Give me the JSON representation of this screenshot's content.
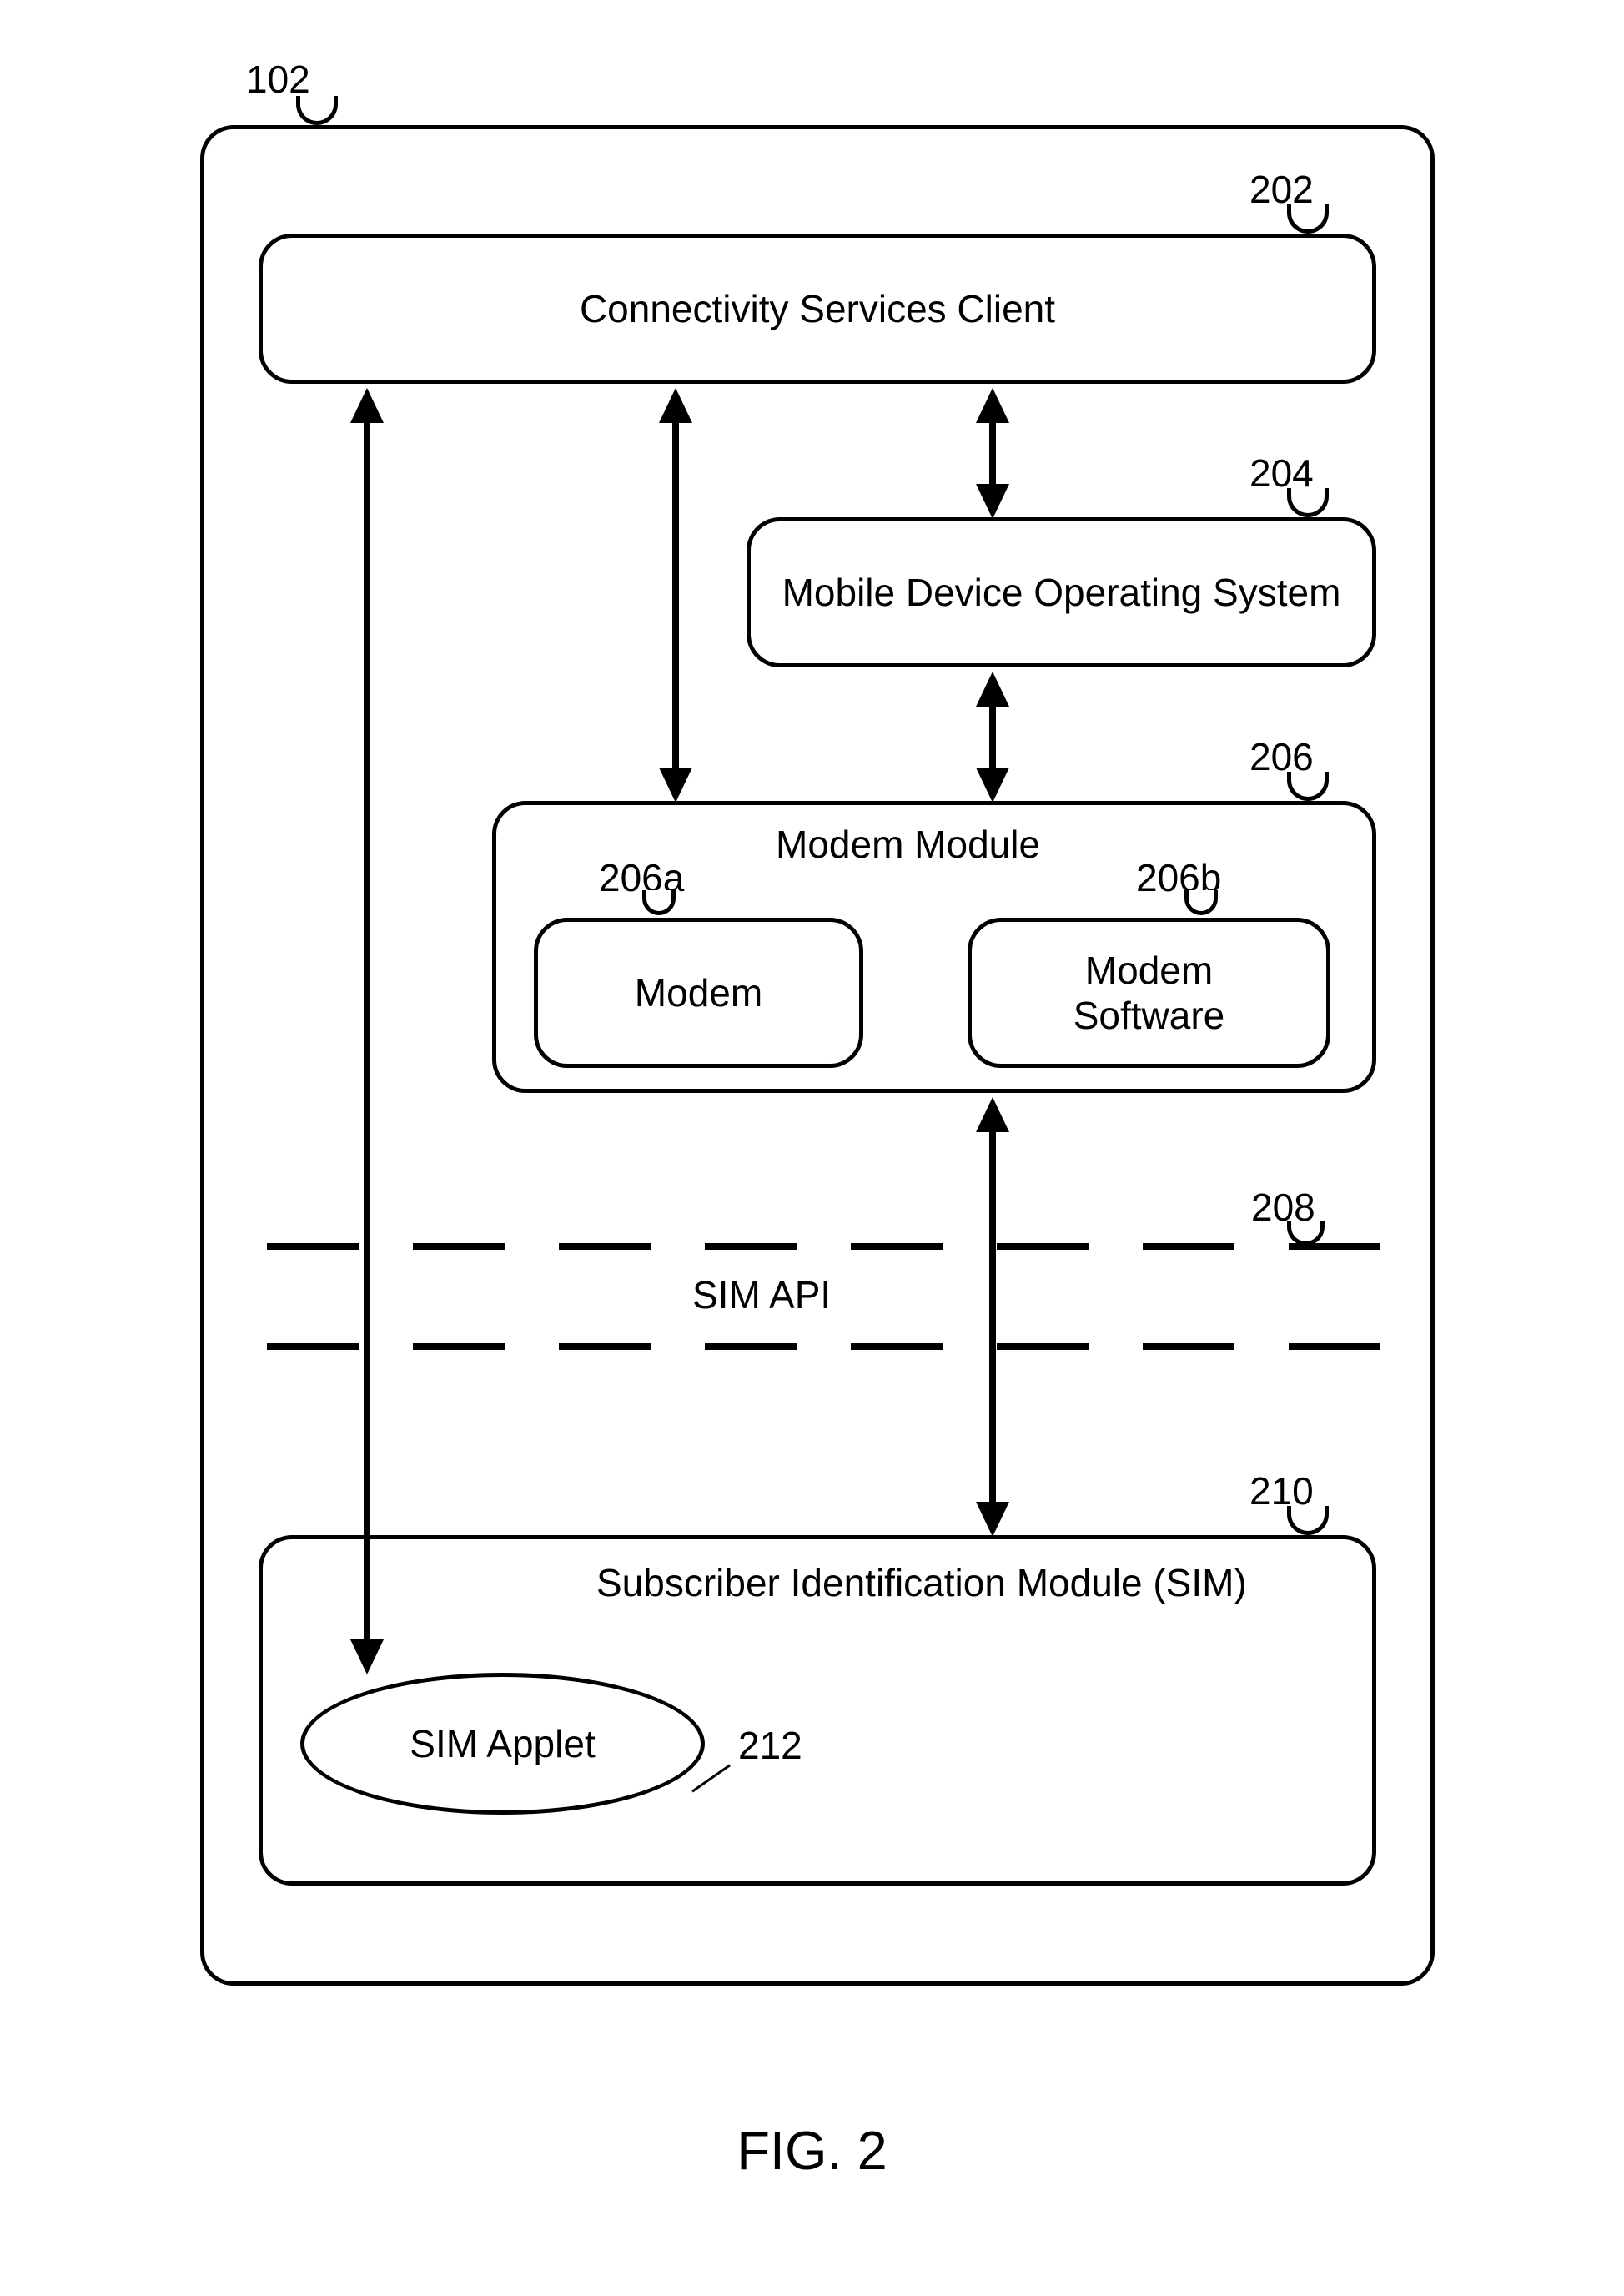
{
  "outer_label": "102",
  "csc": {
    "text": "Connectivity Services Client",
    "ref": "202"
  },
  "os": {
    "text": "Mobile Device Operating System",
    "ref": "204"
  },
  "modem_module": {
    "title": "Modem Module",
    "ref": "206"
  },
  "modem": {
    "text": "Modem",
    "ref": "206a"
  },
  "modem_software": {
    "line1": "Modem",
    "line2": "Software",
    "ref": "206b"
  },
  "sim_api": {
    "text": "SIM API",
    "ref": "208"
  },
  "sim": {
    "text": "Subscriber Identification Module (SIM)",
    "ref": "210"
  },
  "sim_applet": {
    "text": "SIM Applet",
    "ref": "212"
  },
  "figure": "FIG. 2"
}
